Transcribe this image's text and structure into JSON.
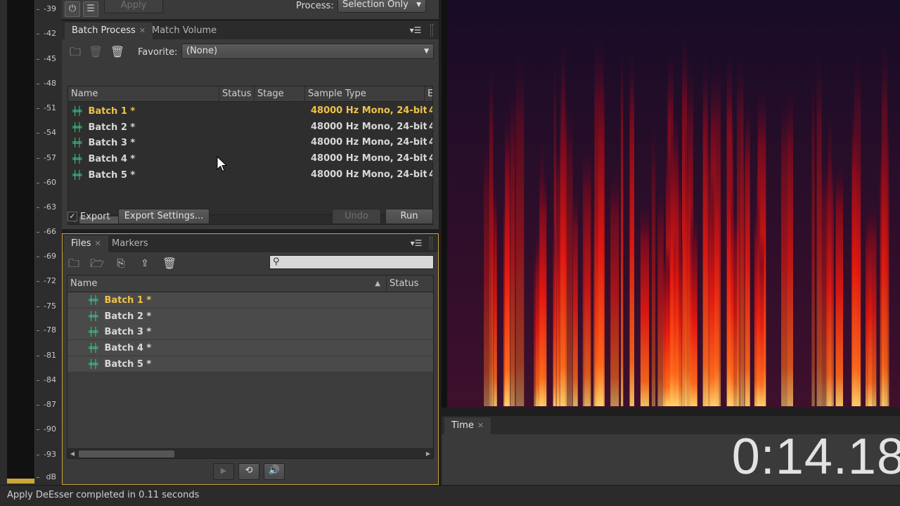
{
  "meter": {
    "ticks": [
      "-39",
      "-42",
      "-45",
      "-48",
      "-51",
      "-54",
      "-57",
      "-60",
      "-63",
      "-66",
      "-69",
      "-72",
      "-75",
      "-78",
      "-81",
      "-84",
      "-87",
      "-90",
      "-93",
      "dB"
    ],
    "level_fraction": 0.01
  },
  "top": {
    "apply_label": "Apply",
    "process_label": "Process:",
    "process_value": "Selection Only"
  },
  "batch": {
    "tabs": [
      "Batch Process",
      "Match Volume"
    ],
    "favorite_label": "Favorite:",
    "favorite_value": "(None)",
    "columns": [
      "Name",
      "Status",
      "Stage",
      "Sample Type",
      "E"
    ],
    "rows": [
      {
        "name": "Batch 1 *",
        "sample": "48000 Hz Mono, 24-bit",
        "extra": "4"
      },
      {
        "name": "Batch 2 *",
        "sample": "48000 Hz Mono, 24-bit",
        "extra": "4"
      },
      {
        "name": "Batch 3 *",
        "sample": "48000 Hz Mono, 24-bit",
        "extra": "4"
      },
      {
        "name": "Batch 4 *",
        "sample": "48000 Hz Mono, 24-bit",
        "extra": "4"
      },
      {
        "name": "Batch 5 *",
        "sample": "48000 Hz Mono, 24-bit",
        "extra": "4"
      }
    ],
    "export_label": "Export",
    "export_settings_label": "Export Settings...",
    "undo_label": "Undo",
    "run_label": "Run"
  },
  "files": {
    "tabs": [
      "Files",
      "Markers"
    ],
    "search_placeholder": "",
    "columns": [
      "Name",
      "Status"
    ],
    "rows": [
      "Batch 1 *",
      "Batch 2 *",
      "Batch 3 *",
      "Batch 4 *",
      "Batch 5 *"
    ]
  },
  "time": {
    "tab": "Time",
    "value": "0:14.18"
  },
  "status": {
    "text": "Apply DeEsser completed in 0.11 seconds"
  },
  "colors": {
    "accent": "#c9a43a",
    "selected_text": "#f0c24a",
    "wave_icon": "#37d18a"
  }
}
